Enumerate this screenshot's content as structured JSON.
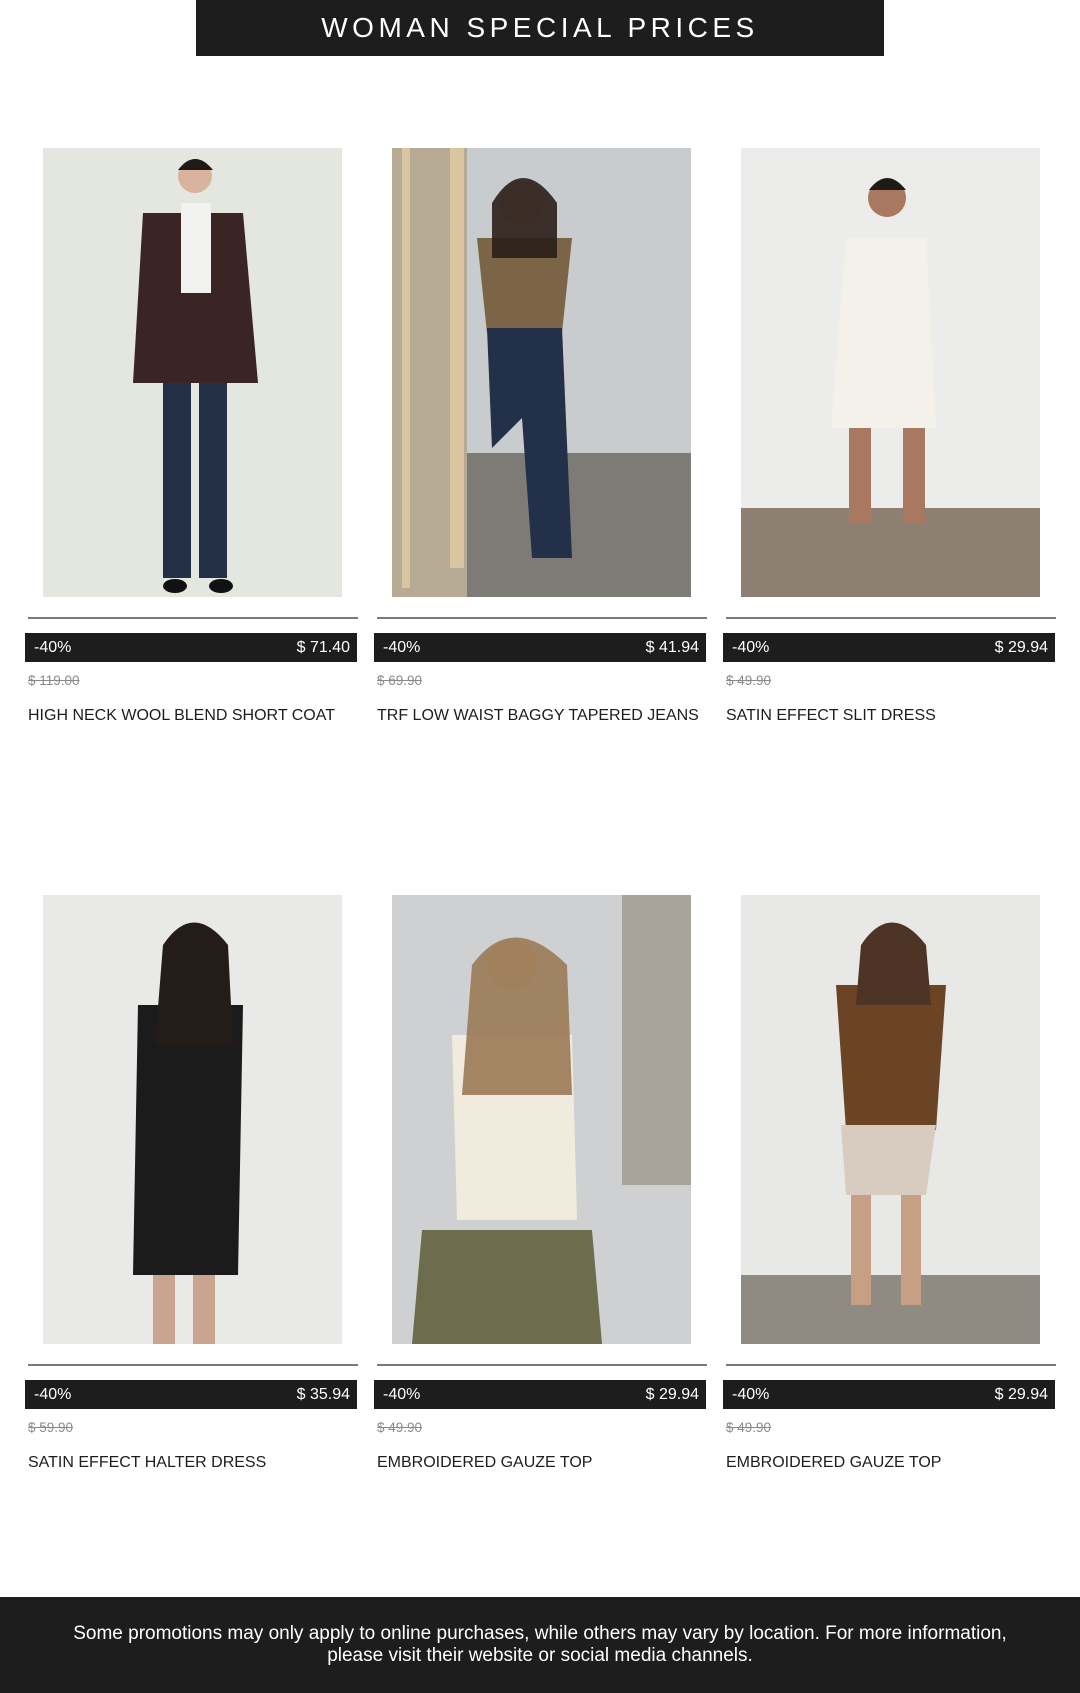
{
  "banner": {
    "title": "WOMAN SPECIAL PRICES"
  },
  "products": [
    {
      "name": "HIGH NECK WOOL BLEND SHORT COAT",
      "discount": "-40%",
      "price": "$ 71.40",
      "old_price": "$ 119.00"
    },
    {
      "name": "TRF LOW WAIST BAGGY TAPERED JEANS",
      "discount": "-40%",
      "price": "$ 41.94",
      "old_price": "$ 69.90"
    },
    {
      "name": "SATIN EFFECT SLIT DRESS",
      "discount": "-40%",
      "price": "$ 29.94",
      "old_price": "$ 49.90"
    },
    {
      "name": "SATIN EFFECT HALTER DRESS",
      "discount": "-40%",
      "price": "$ 35.94",
      "old_price": "$ 59.90"
    },
    {
      "name": "EMBROIDERED GAUZE TOP",
      "discount": "-40%",
      "price": "$ 29.94",
      "old_price": "$ 49.90"
    },
    {
      "name": "EMBROIDERED GAUZE TOP",
      "discount": "-40%",
      "price": "$ 29.94",
      "old_price": "$ 49.90"
    }
  ],
  "footer": {
    "disclaimer": "Some promotions may only apply to online purchases, while others may vary by location. For more information, please visit their website or social media channels."
  },
  "colors": {
    "dark": "#1d1d1d",
    "muted": "#8a8a8a",
    "divider": "#7a7a7a"
  }
}
